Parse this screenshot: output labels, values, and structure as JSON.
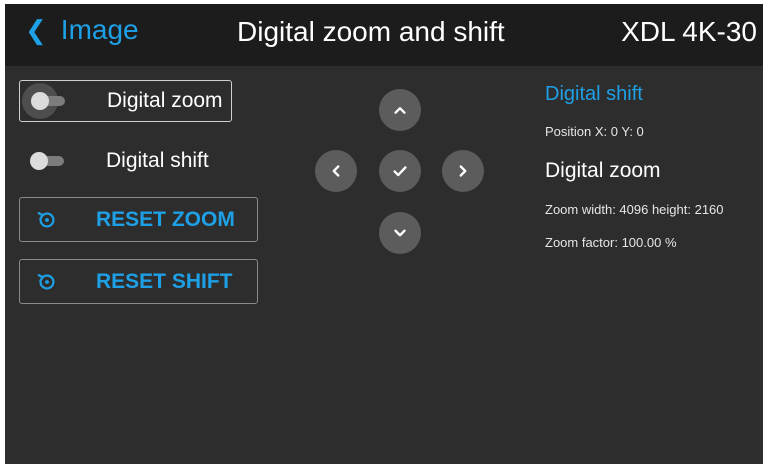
{
  "header": {
    "back_label": "Image",
    "title": "Digital zoom and shift",
    "model": "XDL 4K-30"
  },
  "controls": {
    "toggles": [
      {
        "label": "Digital zoom",
        "on": false,
        "focused": true
      },
      {
        "label": "Digital shift",
        "on": false,
        "focused": false
      }
    ],
    "reset_zoom_label": "RESET ZOOM",
    "reset_shift_label": "RESET SHIFT"
  },
  "dpad": {
    "icons": [
      "chevron-up-icon",
      "chevron-left-icon",
      "check-icon",
      "chevron-right-icon",
      "chevron-down-icon"
    ]
  },
  "info": {
    "shift_heading": "Digital shift",
    "position_text": "Position X: 0 Y: 0",
    "zoom_heading": "Digital zoom",
    "zoom_size_text": "Zoom width: 4096 height: 2160",
    "zoom_factor_text": "Zoom factor: 100.00 %"
  },
  "colors": {
    "accent": "#1ea0e6",
    "background": "#2d2d2d",
    "header_background": "#1c1c1c",
    "pad_button": "#5c5c5c"
  }
}
